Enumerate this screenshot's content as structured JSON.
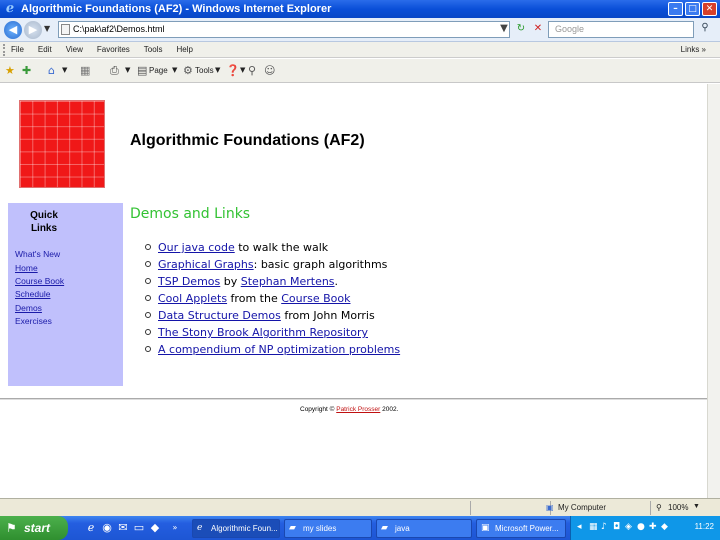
{
  "window": {
    "title": "Algorithmic Foundations (AF2) - Windows Internet Explorer",
    "minimize": "–",
    "maximize": "□",
    "close": "✕"
  },
  "address_bar": {
    "url": "C:\\pak\\af2\\Demos.html",
    "search_placeholder": "Google"
  },
  "menu": {
    "items": [
      "File",
      "Edit",
      "View",
      "Favorites",
      "Tools",
      "Help"
    ],
    "links_label": "Links »"
  },
  "command_bar": {
    "page_label": "Page",
    "tools_label": "Tools"
  },
  "page": {
    "site_title": "Algorithmic Foundations (AF2)",
    "sidebar": {
      "title_line1": "Quick",
      "title_line2": "Links",
      "links": [
        {
          "label": "What's New",
          "underlined": false
        },
        {
          "label": "Home",
          "underlined": true
        },
        {
          "label": "Course Book",
          "underlined": true
        },
        {
          "label": "Schedule",
          "underlined": true
        },
        {
          "label": "Demos",
          "underlined": true
        },
        {
          "label": "Exercises",
          "underlined": false
        }
      ]
    },
    "section_heading": "Demos and Links",
    "demo_items": [
      {
        "link": "Our java code",
        "text": " to walk the walk"
      },
      {
        "link": "Graphical Graphs",
        "text": ": basic graph algorithms"
      },
      {
        "link": "TSP Demos",
        "text": " by ",
        "link2": "Stephan Mertens",
        "text2": "."
      },
      {
        "link": "Cool Applets",
        "text": " from the ",
        "link2": "Course Book",
        "text2": ""
      },
      {
        "link": "Data Structure Demos",
        "text": " from John Morris"
      },
      {
        "link": "The Stony Brook Algorithm Repository",
        "text": ""
      },
      {
        "link": "A compendium of NP optimization problems",
        "text": ""
      }
    ],
    "footer": {
      "prefix": "Copyright © ",
      "author": "Patrick Prosser",
      "suffix": " 2002."
    }
  },
  "status_bar": {
    "zone": "My Computer",
    "zoom": "100%"
  },
  "taskbar": {
    "start_label": "start",
    "buttons": [
      {
        "label": "Algorithmic Foun...",
        "active": true
      },
      {
        "label": "my slides",
        "active": false
      },
      {
        "label": "java",
        "active": false
      },
      {
        "label": "Microsoft Power...",
        "active": false
      }
    ],
    "clock": "11:22"
  },
  "colors": {
    "sidebar_bg": "#c0c0fc",
    "heading_green": "#33c233",
    "link_blue": "#1414a8",
    "logo_red": "#f01818"
  }
}
